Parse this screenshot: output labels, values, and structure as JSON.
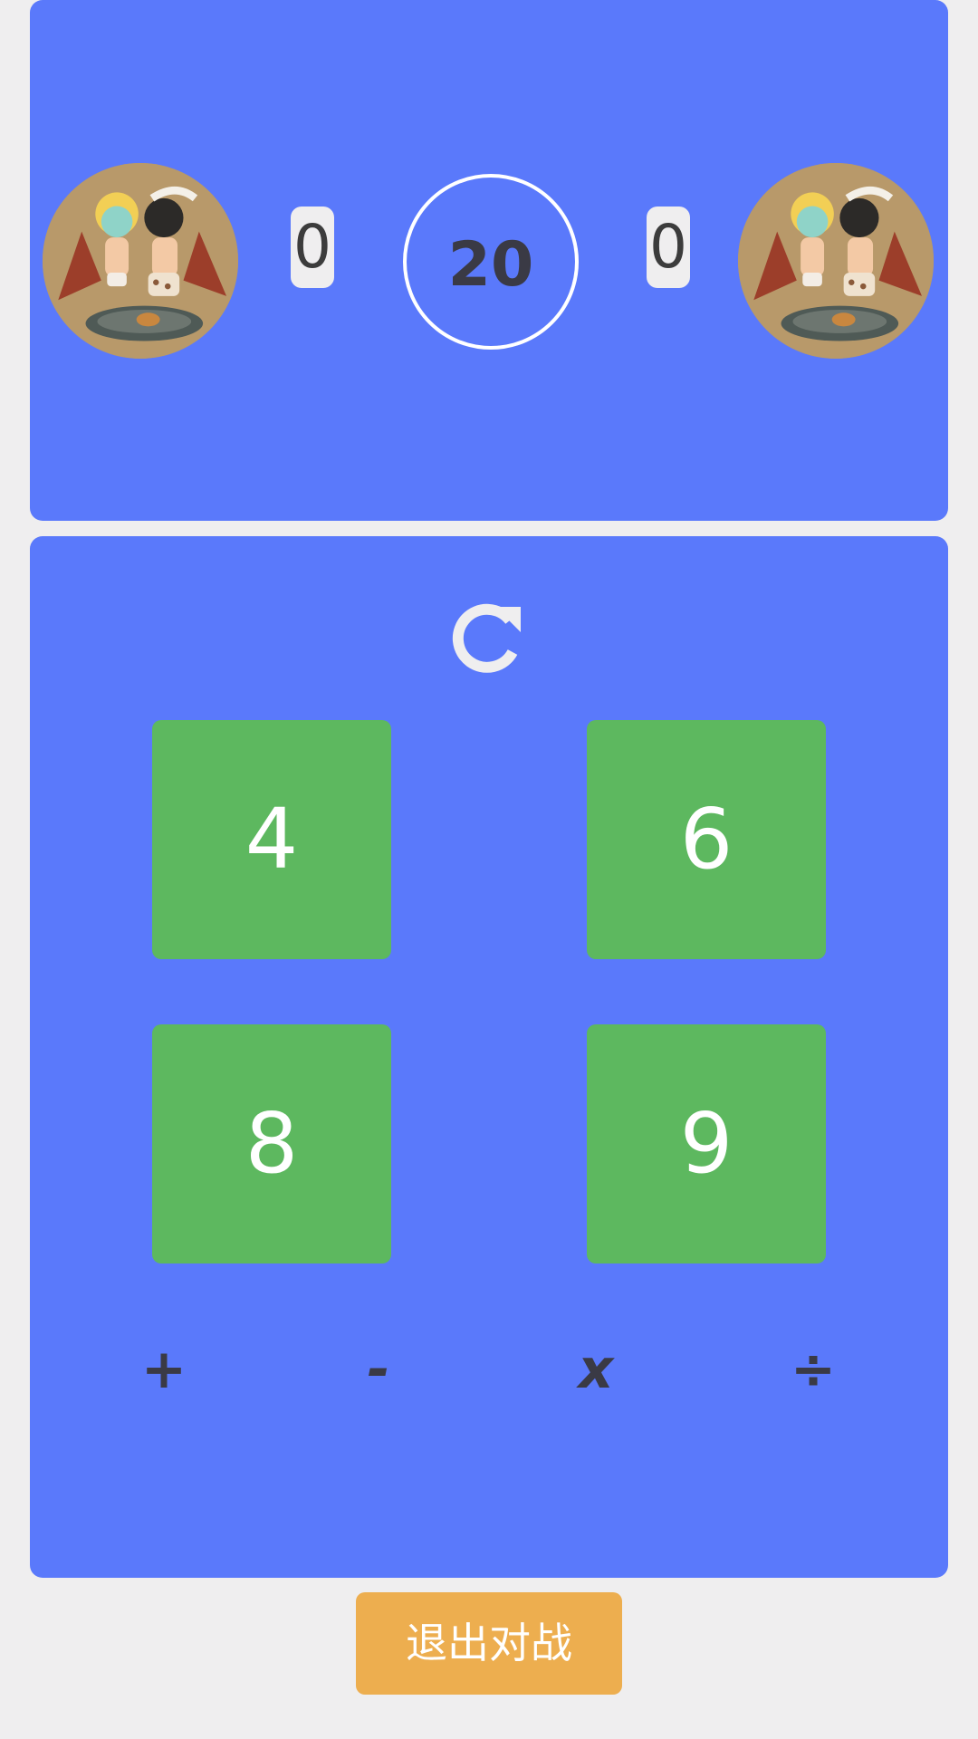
{
  "players": {
    "left": {
      "score": "0",
      "avatar_icon": "avatar-icon"
    },
    "right": {
      "score": "0",
      "avatar_icon": "avatar-icon"
    }
  },
  "timer": {
    "value": "20"
  },
  "board": {
    "refresh_icon": "refresh-icon",
    "numbers": [
      "4",
      "6",
      "8",
      "9"
    ],
    "operators": [
      "+",
      "-",
      "x",
      "÷"
    ]
  },
  "exit_button": {
    "label": "退出对战"
  },
  "colors": {
    "background": "#efeeef",
    "panel": "#5a79fb",
    "card": "#5db85f",
    "exit_button": "#edae4f",
    "text_dark": "#3a3a45"
  }
}
